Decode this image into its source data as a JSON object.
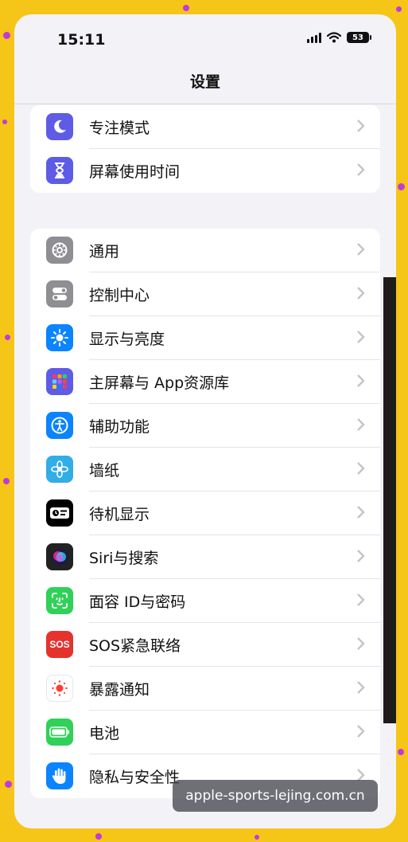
{
  "status_bar": {
    "time": "15:11",
    "battery": "53"
  },
  "nav": {
    "title": "设置"
  },
  "group1": [
    {
      "label": "专注模式",
      "icon": "moon-icon",
      "color": "#5e5ce6"
    },
    {
      "label": "屏幕使用时间",
      "icon": "hourglass-icon",
      "color": "#5e5ce6"
    }
  ],
  "group2": [
    {
      "label": "通用",
      "icon": "gear-icon",
      "color": "#8e8e93"
    },
    {
      "label": "控制中心",
      "icon": "toggles-icon",
      "color": "#8e8e93"
    },
    {
      "label": "显示与亮度",
      "icon": "sun-icon",
      "color": "#0a84ff"
    },
    {
      "label": "主屏幕与 App资源库",
      "icon": "app-grid-icon",
      "color": "#5e5ce6"
    },
    {
      "label": "辅助功能",
      "icon": "accessibility-icon",
      "color": "#0a84ff"
    },
    {
      "label": "墙纸",
      "icon": "flower-icon",
      "color": "#32ade6"
    },
    {
      "label": "待机显示",
      "icon": "standby-icon",
      "color": "#000000"
    },
    {
      "label": "Siri与搜索",
      "icon": "siri-icon",
      "color": "#222222"
    },
    {
      "label": "面容 ID与密码",
      "icon": "face-id-icon",
      "color": "#30d158"
    },
    {
      "label": "SOS紧急联络",
      "icon": "sos-icon",
      "color": "#e5322d"
    },
    {
      "label": "暴露通知",
      "icon": "exposure-icon",
      "color": "#ffffff"
    },
    {
      "label": "电池",
      "icon": "battery-icon",
      "color": "#30d158"
    },
    {
      "label": "隐私与安全性",
      "icon": "hand-icon",
      "color": "#0a84ff"
    }
  ],
  "watermark": "apple-sports-lejing.com.cn"
}
